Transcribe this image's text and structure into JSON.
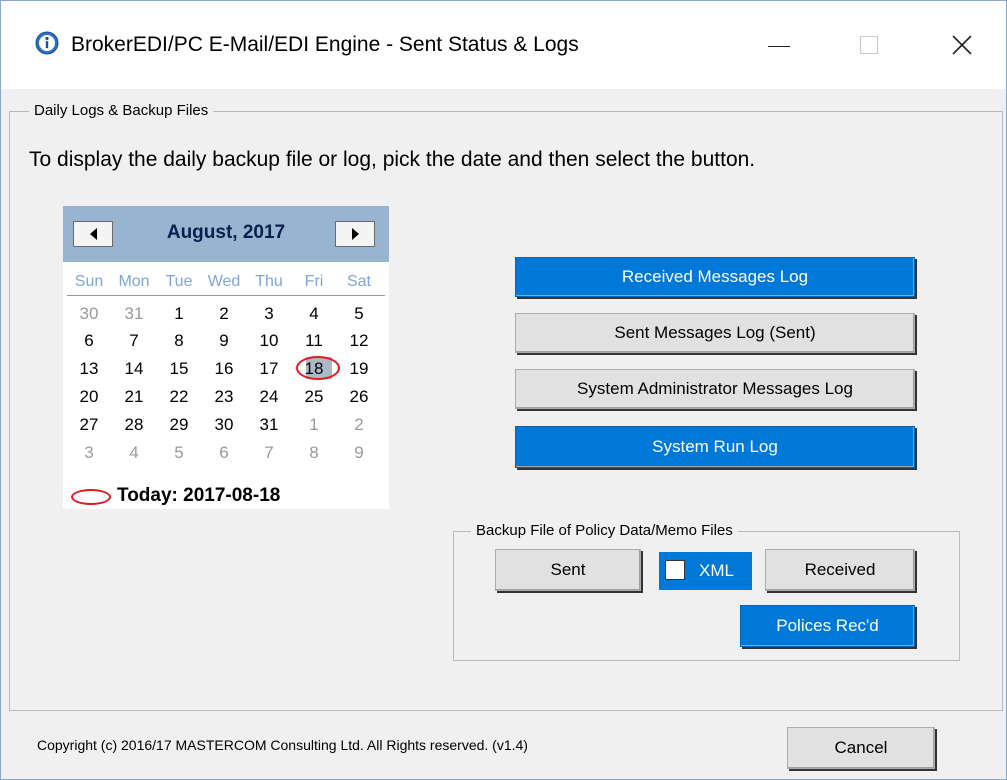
{
  "window": {
    "title": "BrokerEDI/PC E-Mail/EDI Engine - Sent Status  & Logs"
  },
  "daily_group": {
    "legend": "Daily Logs & Backup Files",
    "instruction": "To display the daily backup file or log, pick the date and then select the button."
  },
  "calendar": {
    "month_label": "August, 2017",
    "weekdays": [
      "Sun",
      "Mon",
      "Tue",
      "Wed",
      "Thu",
      "Fri",
      "Sat"
    ],
    "weeks": [
      [
        "30",
        "31",
        "1",
        "2",
        "3",
        "4",
        "5"
      ],
      [
        "6",
        "7",
        "8",
        "9",
        "10",
        "11",
        "12"
      ],
      [
        "13",
        "14",
        "15",
        "16",
        "17",
        "18",
        "19"
      ],
      [
        "20",
        "21",
        "22",
        "23",
        "24",
        "25",
        "26"
      ],
      [
        "27",
        "28",
        "29",
        "30",
        "31",
        "1",
        "2"
      ],
      [
        "3",
        "4",
        "5",
        "6",
        "7",
        "8",
        "9"
      ]
    ],
    "selected_day": "18",
    "today_label": "Today: 2017-08-18"
  },
  "log_buttons": {
    "received": "Received Messages Log",
    "sent": "Sent Messages Log (Sent)",
    "sysadmin": "System Administrator Messages Log",
    "run": "System Run Log"
  },
  "backup_group": {
    "legend": "Backup File of Policy Data/Memo Files",
    "sent_label": "Sent",
    "xml_label": "XML",
    "xml_checked": false,
    "received_label": "Received",
    "policies_label": "Polices Rec'd"
  },
  "footer": {
    "copyright": "Copyright (c) 2016/17 MASTERCOM Consulting Ltd. All Rights reserved.  (v1.4)",
    "cancel_label": "Cancel"
  },
  "colors": {
    "accent_blue": "#0078d7",
    "calendar_header": "#99b4d1",
    "annotation_red": "#e0191c"
  }
}
